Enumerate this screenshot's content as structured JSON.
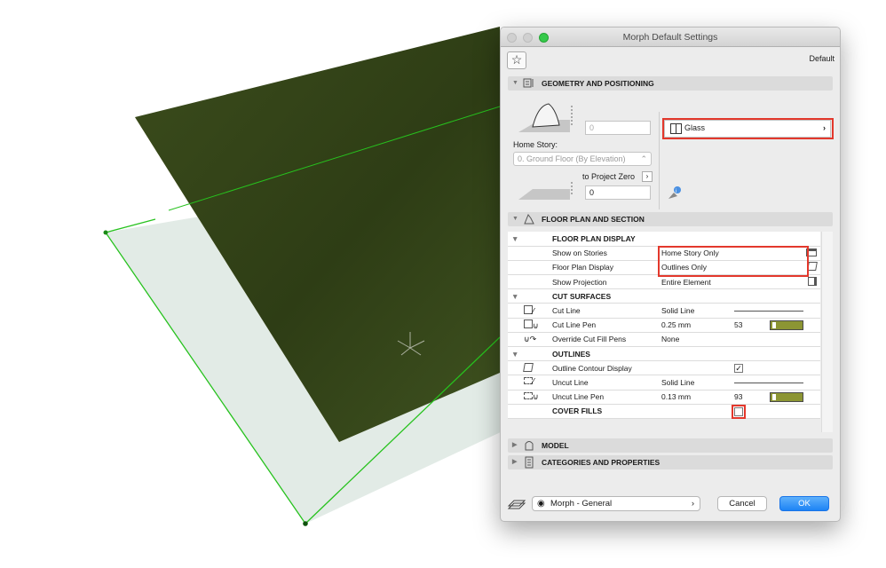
{
  "dialog": {
    "title": "Morph Default Settings",
    "default_label": "Default",
    "favorites_icon": "star-icon"
  },
  "geometry": {
    "header": "GEOMETRY AND POSITIONING",
    "top_offset_value": "0",
    "home_story_label": "Home Story:",
    "home_story_value": "0. Ground Floor (By Elevation)",
    "to_project_zero": "to Project Zero",
    "bottom_offset_value": "0",
    "material_value": "Glass"
  },
  "floor_plan": {
    "header": "FLOOR PLAN AND SECTION",
    "groups": [
      {
        "title": "FLOOR PLAN DISPLAY",
        "rows": [
          {
            "label": "Show on Stories",
            "value": "Home Story Only",
            "icon": "stories-icon"
          },
          {
            "label": "Floor Plan Display",
            "value": "Outlines Only",
            "icon": "cube-outline-icon"
          },
          {
            "label": "Show Projection",
            "value": "Entire Element",
            "icon": "projection-icon"
          }
        ]
      },
      {
        "title": "CUT SURFACES",
        "rows": [
          {
            "label": "Cut Line",
            "value": "Solid Line"
          },
          {
            "label": "Cut Line Pen",
            "value": "0.25 mm",
            "pen": "53"
          },
          {
            "label": "Override Cut Fill Pens",
            "value": "None"
          }
        ]
      },
      {
        "title": "OUTLINES",
        "rows": [
          {
            "label": "Outline Contour Display",
            "checked": true
          },
          {
            "label": "Uncut Line",
            "value": "Solid Line"
          },
          {
            "label": "Uncut Line Pen",
            "value": "0.13 mm",
            "pen": "93"
          }
        ]
      }
    ],
    "cover_fills_label": "COVER FILLS",
    "cover_fills_checked": false
  },
  "model_header": "MODEL",
  "categories_header": "CATEGORIES AND PROPERTIES",
  "footer": {
    "layer_value": "Morph - General",
    "cancel_label": "Cancel",
    "ok_label": "OK"
  },
  "colors": {
    "pen_color": "#8c9533",
    "highlight": "#e3382c",
    "ok_button": "#1d83f5",
    "morph_top": "#394a1c",
    "morph_side": "#b8b27c",
    "selection_green": "#27c21e"
  }
}
